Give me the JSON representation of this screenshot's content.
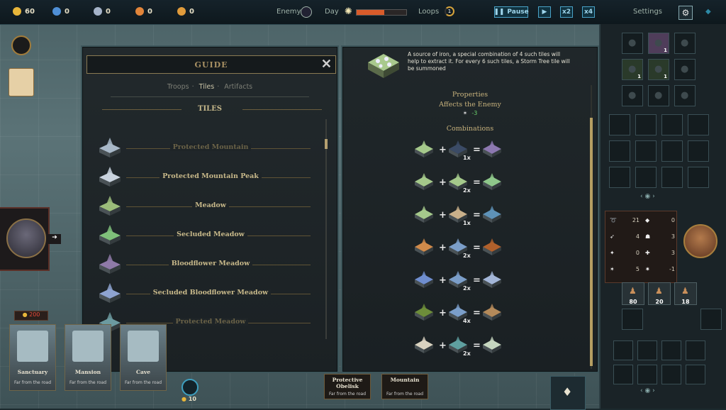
{
  "topbar": {
    "resources": [
      {
        "name": "gold",
        "value": "60",
        "color": "#e8b63a",
        "icon": "gold-coin-icon"
      },
      {
        "name": "potion",
        "value": "0",
        "color": "#4f8fd6",
        "icon": "potion-icon"
      },
      {
        "name": "shard",
        "value": "0",
        "color": "#a5b3c9",
        "icon": "shard-icon"
      },
      {
        "name": "wood",
        "value": "0",
        "color": "#e2853a",
        "icon": "wood-icon"
      },
      {
        "name": "metal",
        "value": "0",
        "color": "#e09b3b",
        "icon": "metal-icon"
      }
    ],
    "enemy_label": "Enemy",
    "day_label": "Day",
    "day_progress": 0.55,
    "loops_label": "Loops",
    "loops_value": "1",
    "pause_label": "Pause",
    "x2_label": "x2",
    "x4_label": "x4",
    "settings_label": "Settings"
  },
  "guide": {
    "title": "GUIDE",
    "tabs": [
      "Troops",
      "Tiles",
      "Artifacts"
    ],
    "active_tab": "Tiles",
    "section": "TILES",
    "items": [
      {
        "label": "Protected Mountain",
        "color": "#6a6247",
        "tile": "#a8b8c8"
      },
      {
        "label": "Protected Mountain Peak",
        "color": "#c8b98a",
        "tile": "#c9d3de"
      },
      {
        "label": "Meadow",
        "color": "#c8b98a",
        "tile": "#9bbc7a"
      },
      {
        "label": "Secluded Meadow",
        "color": "#c8b98a",
        "tile": "#7fc07a"
      },
      {
        "label": "Bloodflower Meadow",
        "color": "#c8b98a",
        "tile": "#8f7aa8"
      },
      {
        "label": "Secluded Bloodflower Meadow",
        "color": "#c8b98a",
        "tile": "#8ea3d0"
      },
      {
        "label": "Protected Meadow",
        "color": "#6a6247",
        "tile": "#6c9aa0"
      }
    ]
  },
  "detail": {
    "description": "A source of iron, a special combination of 4 such tiles will help to extract it. For every 6 such tiles, a Storm Tree tile will be summoned",
    "properties_label": "Properties",
    "affects_label": "Affects the Enemy",
    "affect_value": "-3",
    "combinations_label": "Combinations",
    "combos": [
      {
        "a": "#a5c98b",
        "b": "#3b4b66",
        "mult": "1x",
        "r": "#8c78b0"
      },
      {
        "a": "#a5c98b",
        "b": "#a5c98b",
        "mult": "2x",
        "r": "#8ec78a"
      },
      {
        "a": "#a5c98b",
        "b": "#c9b08a",
        "mult": "1x",
        "r": "#5e92b8"
      },
      {
        "a": "#d08a4a",
        "b": "#7b9ec9",
        "mult": "2x",
        "r": "#b0602c"
      },
      {
        "a": "#6f8ecf",
        "b": "#7b9ec9",
        "mult": "2x",
        "r": "#a3b6d8"
      },
      {
        "a": "#6d8d3a",
        "b": "#7b9ec9",
        "mult": "4x",
        "r": "#b48a5a"
      },
      {
        "a": "#d9d2c0",
        "b": "#5fa0a0",
        "mult": "2x",
        "r": "#c5d6bf"
      }
    ]
  },
  "sidebar": {
    "equip_counts": [
      "1",
      "1",
      "1"
    ],
    "stats": [
      {
        "icon": "damage-icon",
        "value": "21"
      },
      {
        "icon": "evasion-icon",
        "value": "0"
      },
      {
        "icon": "speed-icon",
        "value": "4"
      },
      {
        "icon": "defense-icon",
        "value": "3"
      },
      {
        "icon": "magic-icon",
        "value": "0"
      },
      {
        "icon": "regen-icon",
        "value": "3"
      },
      {
        "icon": "crit-icon",
        "value": "5"
      },
      {
        "icon": "luck-icon",
        "value": "-1"
      }
    ],
    "troops": [
      "80",
      "20",
      "18"
    ]
  },
  "bottom": {
    "food_value": "200",
    "deck_count": "10",
    "cards": [
      {
        "title": "Sanctuary",
        "sub": "Far from the road"
      },
      {
        "title": "Mansion",
        "sub": "Far from the road"
      },
      {
        "title": "Cave",
        "sub": "Far from the road"
      }
    ],
    "tiles": [
      {
        "title": "Protective Obelisk",
        "sub": "Far from the road"
      },
      {
        "title": "Mountain",
        "sub": "Far from the road"
      }
    ]
  }
}
